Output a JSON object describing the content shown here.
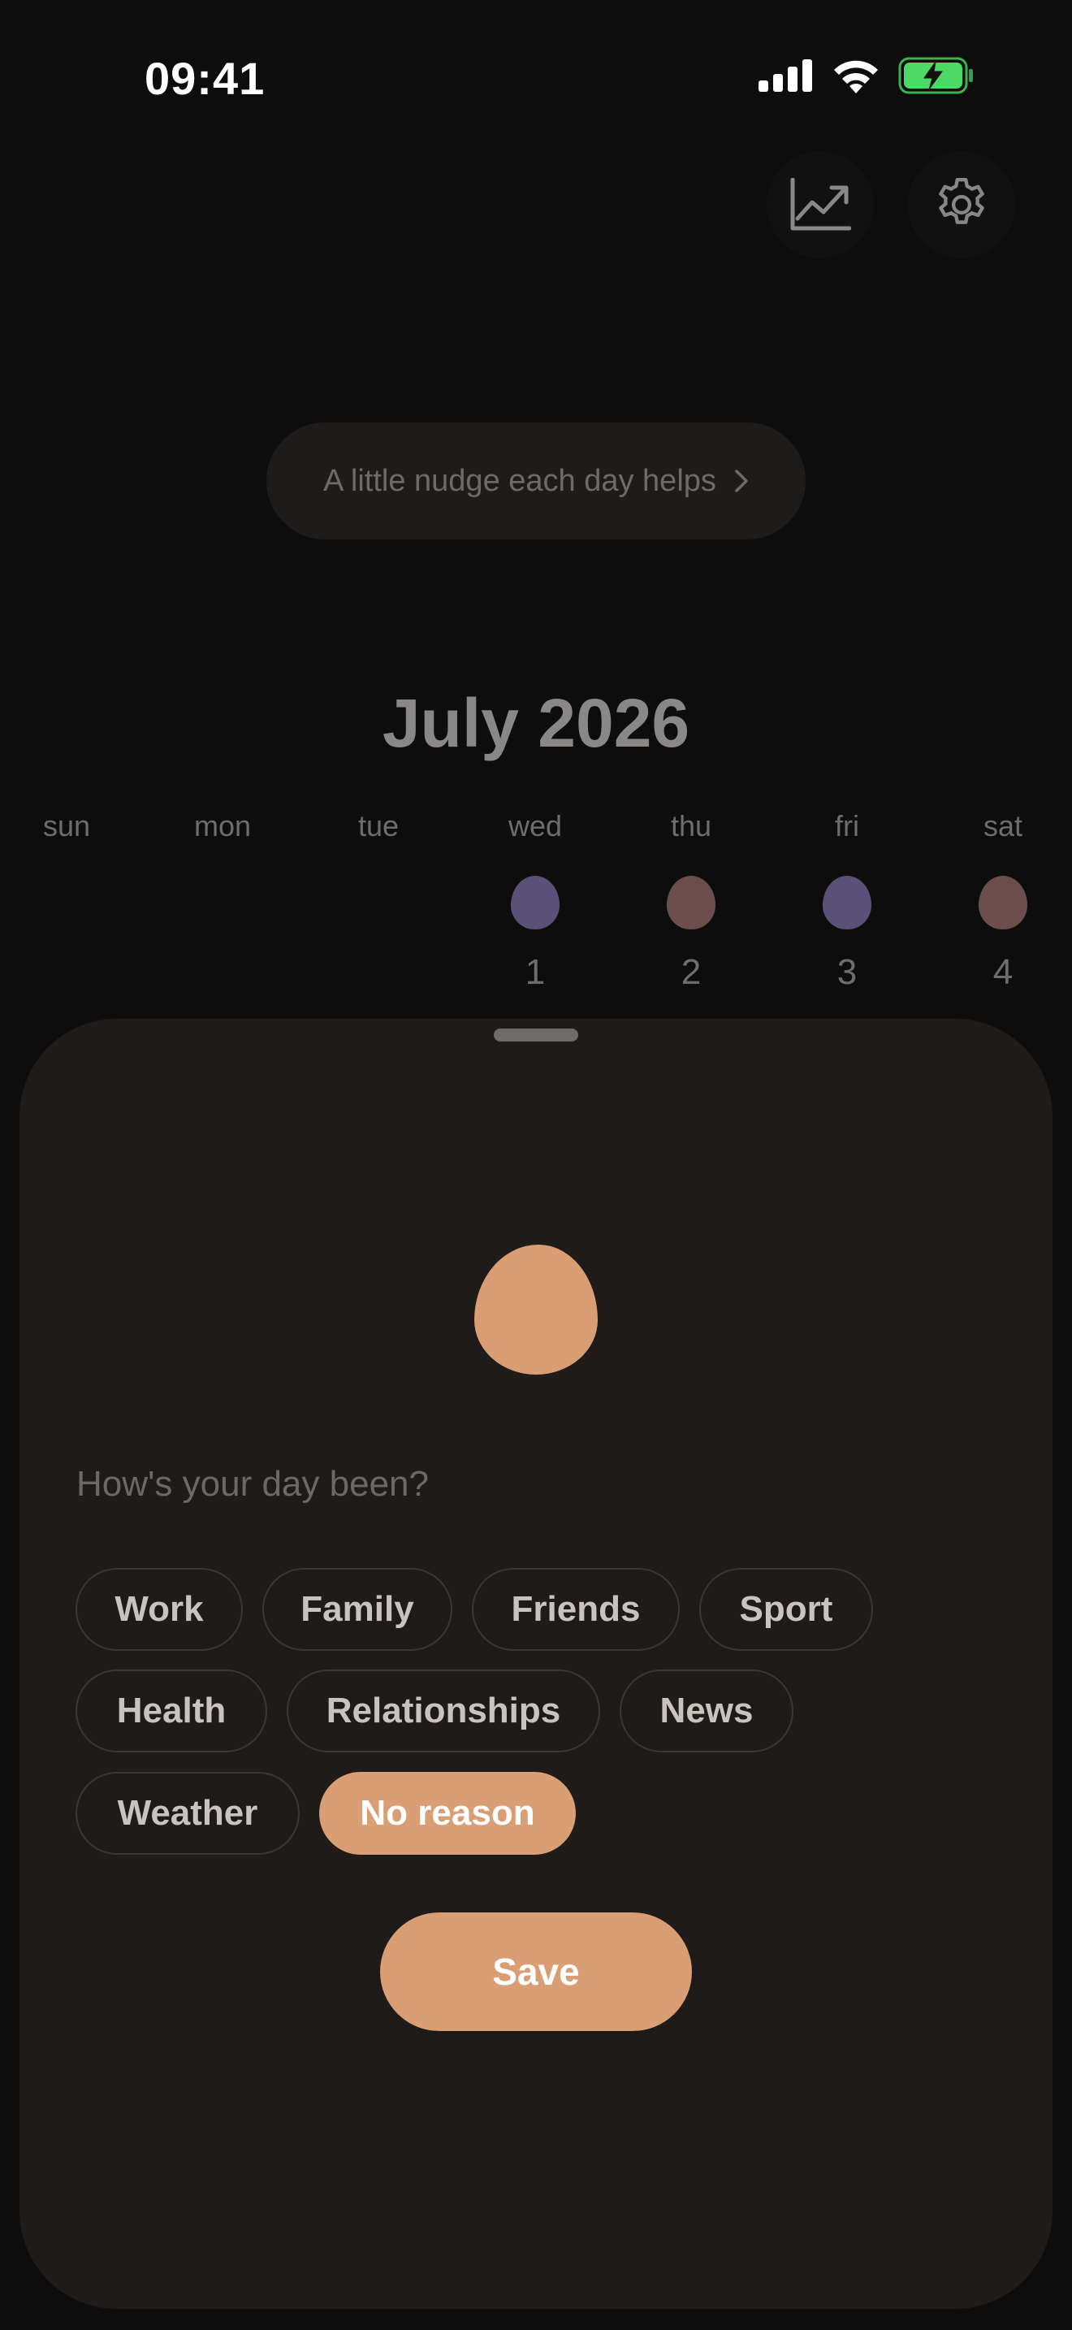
{
  "status_bar": {
    "time": "09:41"
  },
  "toolbar": {
    "stats_icon": "chart-line-icon",
    "settings_icon": "gear-icon"
  },
  "nudge": {
    "label": "A little nudge each day helps"
  },
  "calendar": {
    "month_title": "July 2026",
    "weekdays": [
      "sun",
      "mon",
      "tue",
      "wed",
      "thu",
      "fri",
      "sat"
    ],
    "days": [
      {
        "num": "1",
        "color": "#5b5078"
      },
      {
        "num": "2",
        "color": "#6b4e4c"
      },
      {
        "num": "3",
        "color": "#5b5078"
      },
      {
        "num": "4",
        "color": "#6b4e4c"
      }
    ]
  },
  "sheet": {
    "question_placeholder": "How's your day been?",
    "mood_color": "#d99e74",
    "chips": [
      "Work",
      "Family",
      "Friends",
      "Sport",
      "Health",
      "Relationships",
      "News",
      "Weather",
      "No reason"
    ],
    "selected_chip": "No reason",
    "save_label": "Save"
  },
  "colors": {
    "accent": "#d99e74",
    "battery": "#4cd964"
  }
}
